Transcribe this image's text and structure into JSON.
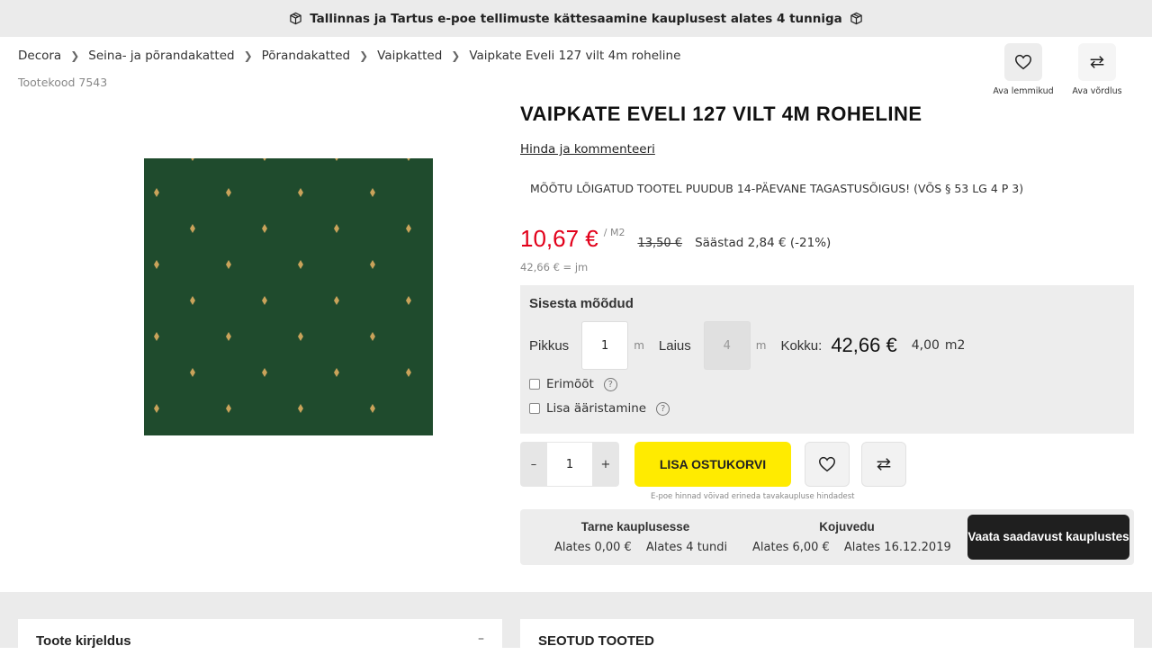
{
  "banner": {
    "text": "Tallinnas ja Tartus e-poe tellimuste kättesaamine kauplusest alates 4 tunniga"
  },
  "breadcrumb": [
    "Decora",
    "Seina- ja põrandakatted",
    "Põrandakatted",
    "Vaipkatted",
    "Vaipkate Eveli 127 vilt 4m roheline"
  ],
  "product_code": "Tootekood 7543",
  "header_actions": {
    "favorites_label": "Ava lemmikud",
    "compare_label": "Ava võrdlus"
  },
  "product": {
    "title": "VAIPKATE EVELI 127 VILT 4M ROHELINE",
    "rate_link": "Hinda ja kommenteeri",
    "return_warning": "MÕÕTU LÕIGATUD TOOTEL PUUDUB 14-PÄEVANE TAGASTUSÕIGUS! (VÕS § 53 LG 4 P 3)",
    "price": "10,67 €",
    "price_unit": "/ M2",
    "old_price": "13,50 €",
    "savings": "Säästad 2,84 € (-21%)",
    "per_meter": "42,66 € = jm",
    "image_color": "#1e4a2c"
  },
  "measure": {
    "heading": "Sisesta mõõdud",
    "length_label": "Pikkus",
    "length_value": "1",
    "length_unit": "m",
    "width_label": "Laius",
    "width_value": "4",
    "width_unit": "m",
    "total_label": "Kokku:",
    "total_value": "42,66 €",
    "area_value": "4,00",
    "area_unit": "m2",
    "custom_size_label": "Erimõõt",
    "edging_label": "Lisa ääristamine"
  },
  "cart": {
    "minus": "–",
    "quantity": "1",
    "plus": "+",
    "add_label": "LISA OSTUKORVI",
    "disclaimer": "E-poe hinnad võivad erineda tavakaupluse hindadest"
  },
  "delivery": {
    "store": {
      "title": "Tarne kauplusesse",
      "price": "Alates 0,00 €",
      "time": "Alates 4 tundi"
    },
    "home": {
      "title": "Kojuvedu",
      "price": "Alates 6,00 €",
      "time": "Alates 16.12.2019"
    },
    "availability_button": "Vaata saadavust kauplustes"
  },
  "sections": {
    "description": "Toote kirjeldus",
    "description_toggle": "–",
    "related": "SEOTUD TOOTED"
  },
  "colors": {
    "accent_yellow": "#ffeb00",
    "price_red": "#e2001a"
  }
}
